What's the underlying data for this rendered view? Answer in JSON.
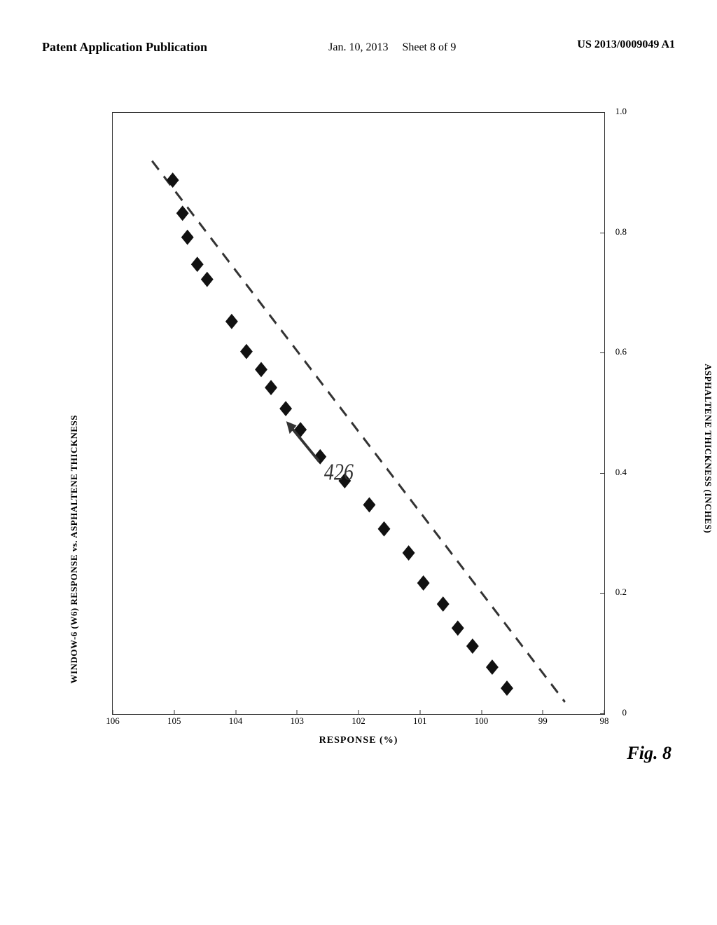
{
  "header": {
    "left": "Patent Application Publication",
    "center_line1": "Jan. 10, 2013",
    "center_line2": "Sheet 8 of 9",
    "right": "US 2013/0009049 A1"
  },
  "chart": {
    "y_axis_label": "WINDOW-6 (W6) RESPONSE vs. ASPHALTENE THICKNESS",
    "x_axis_label": "RESPONSE (%)",
    "right_y_axis_label": "ASPHALTENE THICKNESS (INCHES)",
    "figure_label": "Fig. 8",
    "annotation_label": "426",
    "x_ticks": [
      "106",
      "105",
      "104",
      "103",
      "102",
      "101",
      "100",
      "99",
      "98"
    ],
    "right_y_ticks": [
      {
        "label": "0",
        "pct": 0
      },
      {
        "label": "0.2",
        "pct": 20
      },
      {
        "label": "0.4",
        "pct": 40
      },
      {
        "label": "0.6",
        "pct": 60
      },
      {
        "label": "0.8",
        "pct": 80
      },
      {
        "label": "1.0",
        "pct": 100
      }
    ],
    "data_points": [
      {
        "x_pct": 12,
        "y_pct": 88
      },
      {
        "x_pct": 14,
        "y_pct": 82
      },
      {
        "x_pct": 15,
        "y_pct": 79
      },
      {
        "x_pct": 17,
        "y_pct": 74
      },
      {
        "x_pct": 19,
        "y_pct": 72
      },
      {
        "x_pct": 24,
        "y_pct": 65
      },
      {
        "x_pct": 27,
        "y_pct": 60
      },
      {
        "x_pct": 30,
        "y_pct": 57
      },
      {
        "x_pct": 32,
        "y_pct": 54
      },
      {
        "x_pct": 35,
        "y_pct": 50
      },
      {
        "x_pct": 38,
        "y_pct": 47
      },
      {
        "x_pct": 42,
        "y_pct": 42
      },
      {
        "x_pct": 47,
        "y_pct": 38
      },
      {
        "x_pct": 52,
        "y_pct": 34
      },
      {
        "x_pct": 55,
        "y_pct": 30
      },
      {
        "x_pct": 60,
        "y_pct": 26
      },
      {
        "x_pct": 63,
        "y_pct": 21
      },
      {
        "x_pct": 67,
        "y_pct": 18
      },
      {
        "x_pct": 70,
        "y_pct": 14
      },
      {
        "x_pct": 73,
        "y_pct": 11
      },
      {
        "x_pct": 77,
        "y_pct": 7
      },
      {
        "x_pct": 80,
        "y_pct": 4
      }
    ]
  }
}
